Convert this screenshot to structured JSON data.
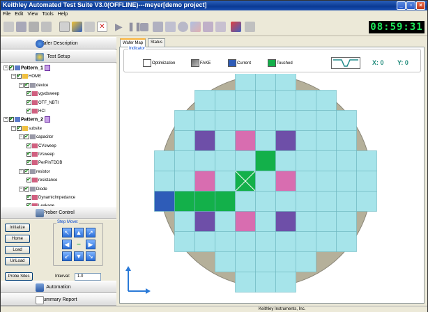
{
  "window": {
    "title": "Keithley Automated Test Suite V3.0(OFFLINE)---meyer[demo project]"
  },
  "menu": [
    "File",
    "Edit",
    "View",
    "Tools",
    "Help"
  ],
  "toolbar": {
    "clock": "08:59:31"
  },
  "left": {
    "wafer_description": "Wafer Description",
    "test_setup": "Test Setup",
    "tree": [
      {
        "label": "Pattern_1",
        "level": 0,
        "bold": true,
        "pattern": true
      },
      {
        "label": "HOME",
        "level": 1
      },
      {
        "label": "device",
        "level": 2
      },
      {
        "label": "vgvdsweep",
        "level": 3
      },
      {
        "label": "OTF_NBTI",
        "level": 3
      },
      {
        "label": "HCI",
        "level": 3
      },
      {
        "label": "Pattern_2",
        "level": 0,
        "bold": true,
        "pattern": true
      },
      {
        "label": "subsite",
        "level": 1
      },
      {
        "label": "capacitor",
        "level": 2
      },
      {
        "label": "CVsweep",
        "level": 3
      },
      {
        "label": "IVsweep",
        "level": 3
      },
      {
        "label": "PerPinTDDB",
        "level": 3
      },
      {
        "label": "resistor",
        "level": 2
      },
      {
        "label": "resistance",
        "level": 3
      },
      {
        "label": "Diode",
        "level": 2
      },
      {
        "label": "DynamicImpedance",
        "level": 3
      },
      {
        "label": "Leakage",
        "level": 3
      }
    ],
    "prober_control": "Prober Control",
    "buttons": {
      "initialize": "Initialize",
      "home": "Home",
      "load": "Load",
      "unload": "UnLoad",
      "probe_sites": "Probe Sites"
    },
    "step_move": "Step Move:",
    "interval_label": "Interval:",
    "interval_value": "1.0",
    "automation": "Automation",
    "summary_report": "Summary Report"
  },
  "tabs": [
    "Wafer Map",
    "Status"
  ],
  "indicator": {
    "title": "Indicator",
    "legend": [
      {
        "label": "Optimization",
        "color": "#ffffff"
      },
      {
        "label": "FAKE",
        "color": "#9a9a9a"
      },
      {
        "label": "Current",
        "color": "#2e5cb8"
      },
      {
        "label": "Touched",
        "color": "#13b04a"
      }
    ],
    "x_label": "X:",
    "x_value": "0",
    "y_label": "Y:",
    "y_value": "0"
  },
  "wafer": {
    "colors": {
      "wafer": "#b5b09a",
      "die": "#a6e4ea",
      "die_border": "#6fb8c0",
      "purple": "#6e4fa8",
      "pink": "#d86db0",
      "green": "#13b04a",
      "blue": "#2e5cb8"
    },
    "rows": [
      {
        "row": 0,
        "from": 4,
        "to": 6
      },
      {
        "row": 1,
        "from": 2,
        "to": 8
      },
      {
        "row": 2,
        "from": 1,
        "to": 9
      },
      {
        "row": 3,
        "from": 1,
        "to": 9
      },
      {
        "row": 4,
        "from": 0,
        "to": 10
      },
      {
        "row": 5,
        "from": 0,
        "to": 10
      },
      {
        "row": 6,
        "from": 0,
        "to": 10
      },
      {
        "row": 7,
        "from": 1,
        "to": 9
      },
      {
        "row": 8,
        "from": 1,
        "to": 9
      },
      {
        "row": 9,
        "from": 3,
        "to": 7
      },
      {
        "row": 10,
        "from": 4,
        "to": 6
      }
    ],
    "special": [
      {
        "row": 3,
        "col": 2,
        "type": "purple"
      },
      {
        "row": 3,
        "col": 4,
        "type": "pink"
      },
      {
        "row": 3,
        "col": 6,
        "type": "purple"
      },
      {
        "row": 4,
        "col": 5,
        "type": "green"
      },
      {
        "row": 5,
        "col": 2,
        "type": "pink"
      },
      {
        "row": 5,
        "col": 4,
        "type": "touched-x"
      },
      {
        "row": 5,
        "col": 6,
        "type": "pink"
      },
      {
        "row": 6,
        "col": 0,
        "type": "blue"
      },
      {
        "row": 6,
        "col": 1,
        "type": "green"
      },
      {
        "row": 6,
        "col": 2,
        "type": "green"
      },
      {
        "row": 6,
        "col": 3,
        "type": "green"
      },
      {
        "row": 7,
        "col": 2,
        "type": "purple"
      },
      {
        "row": 7,
        "col": 4,
        "type": "pink"
      },
      {
        "row": 7,
        "col": 6,
        "type": "purple"
      }
    ]
  },
  "status": {
    "company": "Keithley Instruments, Inc."
  }
}
